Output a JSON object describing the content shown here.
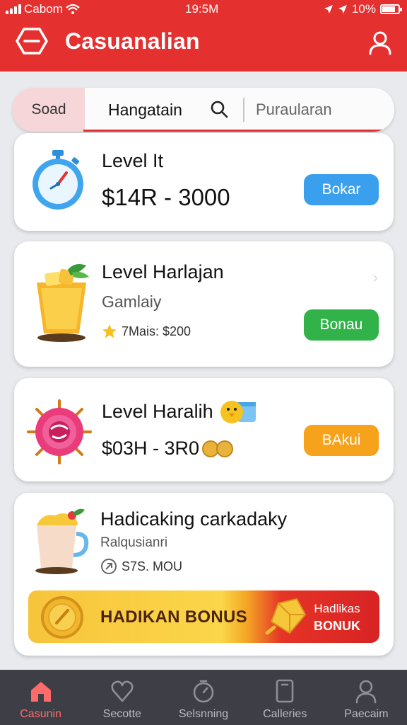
{
  "status_bar": {
    "carrier": "Cabom",
    "time": "19:5M",
    "battery": "10%"
  },
  "header": {
    "title": "Casuanalian"
  },
  "filter": {
    "chip": "Soad",
    "label": "Hangatain",
    "search_placeholder": "Puraularan"
  },
  "cards": [
    {
      "title": "Level It",
      "price": "$14R - 3000",
      "button": "Bokar",
      "button_color": "#3aa0ee",
      "thumb": "stopwatch-icon"
    },
    {
      "title": "Level Harlajan",
      "subtitle": "Gamlaiy",
      "meta": "7Mais: $200",
      "button": "Bonau",
      "button_color": "#31b34a",
      "thumb": "juice-glass-icon"
    },
    {
      "title": "Level Haralih",
      "price": "$03H - 3R0",
      "button": "BAkui",
      "button_color": "#f7a21b",
      "thumb": "pink-badge-icon"
    },
    {
      "title": "Hadicaking carkadaky",
      "subtitle": "Ralqusianri",
      "meta": "S7S. MOU",
      "thumb": "smoothie-cup-icon",
      "banner": {
        "text": "HADIKAN BONUS",
        "right_line1": "Hadlikas",
        "right_line2": "BONUK"
      }
    }
  ],
  "bottom_nav": [
    {
      "label": "Casunin",
      "icon": "home-icon",
      "active": true
    },
    {
      "label": "Secotte",
      "icon": "heart-icon",
      "active": false
    },
    {
      "label": "Selsnning",
      "icon": "timer-icon",
      "active": false
    },
    {
      "label": "Calleries",
      "icon": "tablet-icon",
      "active": false
    },
    {
      "label": "Paecaim",
      "icon": "person-icon",
      "active": false
    }
  ],
  "colors": {
    "brand_red": "#e53030",
    "nav_background": "#3e3f46"
  }
}
